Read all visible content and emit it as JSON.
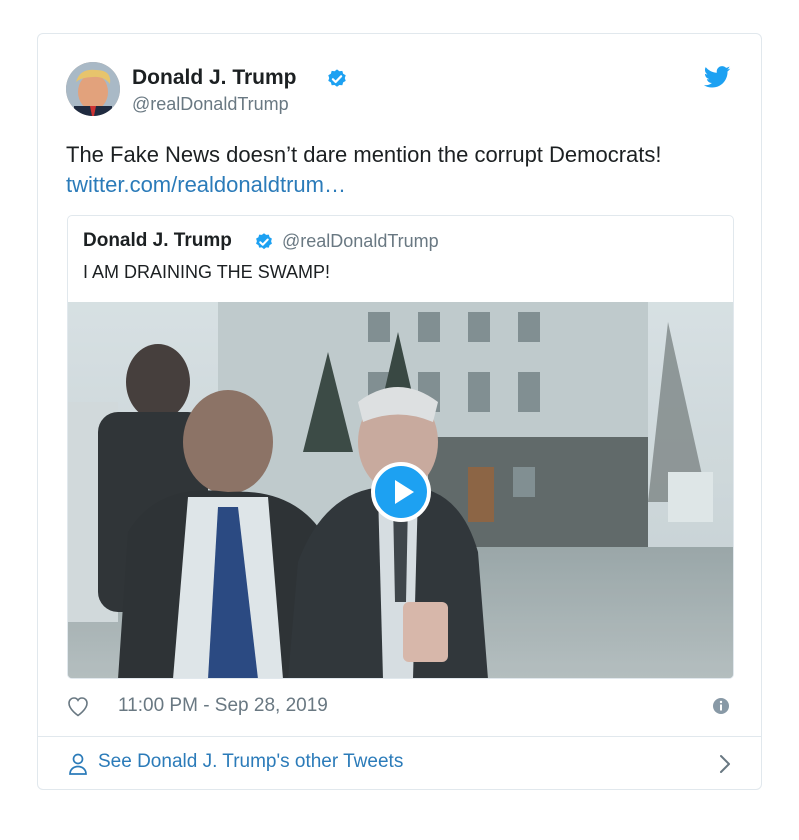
{
  "tweet": {
    "author": {
      "name": "Donald J. Trump",
      "handle": "@realDonaldTrump",
      "verified": true,
      "avatar_icon": "avatar-photo"
    },
    "text": "The Fake News doesn’t dare mention the corrupt Democrats!",
    "link_text": "twitter.com/realdonaldtrum…",
    "quoted": {
      "name": "Donald J. Trump",
      "handle": "@realDonaldTrump",
      "verified": true,
      "text": "I AM DRAINING THE SWAMP!",
      "media": {
        "type": "video",
        "play_icon": "play-icon"
      }
    },
    "meta": {
      "like_icon": "heart-icon",
      "timestamp": "11:00 PM - Sep 28, 2019",
      "info_icon": "info-icon"
    },
    "footer": {
      "person_icon": "person-icon",
      "see_more_label": "See Donald J. Trump's other Tweets",
      "chevron_icon": "chevron-right-icon"
    }
  },
  "colors": {
    "link": "#2b7bb9",
    "twitter_blue": "#1da1f2",
    "secondary_text": "#697882",
    "border": "#e1e8ed"
  }
}
